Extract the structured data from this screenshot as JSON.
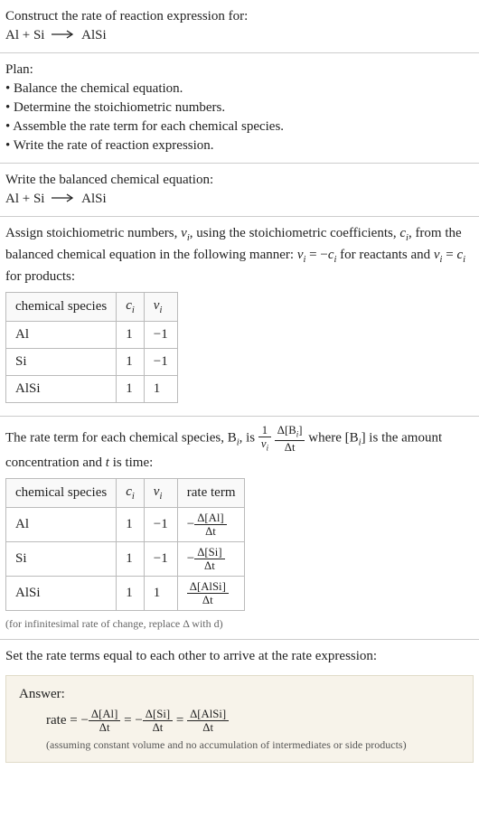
{
  "intro": {
    "prompt": "Construct the rate of reaction expression for:",
    "equation_lhs": "Al + Si",
    "equation_rhs": "AlSi"
  },
  "plan": {
    "heading": "Plan:",
    "items": [
      "Balance the chemical equation.",
      "Determine the stoichiometric numbers.",
      "Assemble the rate term for each chemical species.",
      "Write the rate of reaction expression."
    ]
  },
  "balanced": {
    "heading": "Write the balanced chemical equation:",
    "lhs": "Al + Si",
    "rhs": "AlSi"
  },
  "stoich": {
    "text_a": "Assign stoichiometric numbers, ",
    "nu_i": "ν",
    "text_b": ", using the stoichiometric coefficients, ",
    "c_i": "c",
    "text_c": ", from the balanced chemical equation in the following manner: ",
    "rel_reactants_lhs": "ν",
    "rel_reactants_mid": " = −",
    "rel_reactants_rhs": "c",
    "text_d": " for reactants and ",
    "rel_products_lhs": "ν",
    "rel_products_mid": " = ",
    "rel_products_rhs": "c",
    "text_e": " for products:",
    "headers": {
      "species": "chemical species",
      "c": "c",
      "nu": "ν"
    },
    "rows": [
      {
        "species": "Al",
        "c": "1",
        "nu": "−1"
      },
      {
        "species": "Si",
        "c": "1",
        "nu": "−1"
      },
      {
        "species": "AlSi",
        "c": "1",
        "nu": "1"
      }
    ]
  },
  "rateterm": {
    "text_a": "The rate term for each chemical species, B",
    "text_b": ", is ",
    "frac1_num": "1",
    "frac1_den_sym": "ν",
    "frac2_num": "Δ[B",
    "frac2_num_close": "]",
    "frac2_den": "Δt",
    "text_c": " where [B",
    "text_d": "] is the amount concentration and ",
    "t_var": "t",
    "text_e": " is time:",
    "headers": {
      "species": "chemical species",
      "c": "c",
      "nu": "ν",
      "term": "rate term"
    },
    "rows": [
      {
        "species": "Al",
        "c": "1",
        "nu": "−1",
        "neg": "−",
        "num": "Δ[Al]",
        "den": "Δt"
      },
      {
        "species": "Si",
        "c": "1",
        "nu": "−1",
        "neg": "−",
        "num": "Δ[Si]",
        "den": "Δt"
      },
      {
        "species": "AlSi",
        "c": "1",
        "nu": "1",
        "neg": "",
        "num": "Δ[AlSi]",
        "den": "Δt"
      }
    ],
    "note": "(for infinitesimal rate of change, replace Δ with d)"
  },
  "final": {
    "heading": "Set the rate terms equal to each other to arrive at the rate expression:",
    "answer_label": "Answer:",
    "rate_word": "rate = ",
    "neg": "−",
    "t1_num": "Δ[Al]",
    "t1_den": "Δt",
    "eq1": " = ",
    "t2_num": "Δ[Si]",
    "t2_den": "Δt",
    "eq2": " = ",
    "t3_num": "Δ[AlSi]",
    "t3_den": "Δt",
    "assumption": "(assuming constant volume and no accumulation of intermediates or side products)"
  },
  "sub_i": "i",
  "chart_data": {
    "type": "table",
    "tables": [
      {
        "title": "stoichiometric numbers",
        "columns": [
          "chemical species",
          "c_i",
          "nu_i"
        ],
        "rows": [
          [
            "Al",
            1,
            -1
          ],
          [
            "Si",
            1,
            -1
          ],
          [
            "AlSi",
            1,
            1
          ]
        ]
      },
      {
        "title": "rate terms",
        "columns": [
          "chemical species",
          "c_i",
          "nu_i",
          "rate term"
        ],
        "rows": [
          [
            "Al",
            1,
            -1,
            "-Δ[Al]/Δt"
          ],
          [
            "Si",
            1,
            -1,
            "-Δ[Si]/Δt"
          ],
          [
            "AlSi",
            1,
            1,
            "Δ[AlSi]/Δt"
          ]
        ]
      }
    ]
  }
}
